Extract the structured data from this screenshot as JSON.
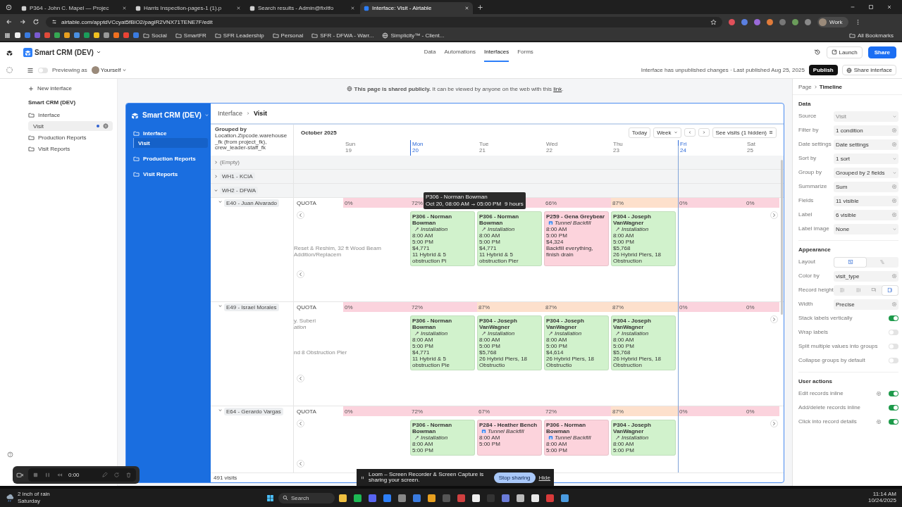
{
  "browser": {
    "tabs": [
      {
        "title": "P364 - John C. Mapel — Projec",
        "selected": false
      },
      {
        "title": "Harris Inspection-pages-1 (1).p",
        "selected": false
      },
      {
        "title": "Search results - Admin@fixitfo",
        "selected": false
      },
      {
        "title": "Interface: Visit - Airtable",
        "selected": true
      }
    ],
    "url": "airtable.com/apptdVCcyat5fBlO2/pagiR2VNX71TENE7F/edit",
    "bookmarks": [
      {
        "label": "Social",
        "kind": "folder"
      },
      {
        "label": "SmartFR",
        "kind": "folder"
      },
      {
        "label": "SFR Leadership",
        "kind": "folder"
      },
      {
        "label": "Personal",
        "kind": "folder"
      },
      {
        "label": "SFR - DFWA - Warr...",
        "kind": "folder"
      },
      {
        "label": "Simplicity™ - Client...",
        "kind": "link"
      }
    ],
    "all_bookmarks": "All Bookmarks",
    "profile": "Work"
  },
  "app": {
    "title": "Smart CRM (DEV)",
    "nav": [
      {
        "label": "Data",
        "selected": false
      },
      {
        "label": "Automations",
        "selected": false
      },
      {
        "label": "Interfaces",
        "selected": true
      },
      {
        "label": "Forms",
        "selected": false
      }
    ],
    "launch": "Launch",
    "share": "Share"
  },
  "subbar": {
    "preview_on": false,
    "previewing": "Previewing as",
    "user": "Yourself",
    "status": "Interface has unpublished changes · Last published Aug 25, 2025",
    "publish": "Publish",
    "share_interface": "Share interface"
  },
  "sidebar": {
    "new": "New interface",
    "base": "Smart CRM (DEV)",
    "items": [
      {
        "label": "Interface",
        "selected": false,
        "children": [
          {
            "label": "Visit",
            "selected": true
          }
        ]
      },
      {
        "label": "Production Reports",
        "selected": false
      },
      {
        "label": "Visit Reports",
        "selected": false
      }
    ]
  },
  "notice": {
    "text": "**This page is shared publicly.** It can be viewed by anyone on the web with this",
    "link": "link",
    "end": "."
  },
  "preview": {
    "title": "Smart CRM (DEV)",
    "nav": [
      {
        "label": "Interface",
        "selected": false,
        "children": [
          {
            "label": "Visit",
            "selected": true
          }
        ]
      },
      {
        "label": "Production Reports",
        "selected": false
      },
      {
        "label": "Visit Reports",
        "selected": false
      }
    ],
    "breadcrumb": [
      "Interface",
      "Visit"
    ],
    "grouped_by_label": "Grouped by",
    "grouped_by": "Location.Zipcode.warehouse_fk (from project_fk), crew_leader-staff_fk",
    "count": "491 visits",
    "timeline": {
      "month": "October 2025",
      "today": "Today",
      "range": "Week",
      "see": "See visits (1 hidden)",
      "days": [
        {
          "name": "Sun",
          "date": "19",
          "highlighted": false,
          "today": false
        },
        {
          "name": "Mon",
          "date": "20",
          "highlighted": true,
          "today": false
        },
        {
          "name": "Tue",
          "date": "21",
          "highlighted": false,
          "today": false
        },
        {
          "name": "Wed",
          "date": "22",
          "highlighted": false,
          "today": false
        },
        {
          "name": "Thu",
          "date": "23",
          "highlighted": false,
          "today": false
        },
        {
          "name": "Fri",
          "date": "24",
          "highlighted": true,
          "today": true
        },
        {
          "name": "Sat",
          "date": "25",
          "highlighted": false,
          "today": false
        }
      ],
      "groups": [
        {
          "label": "(Empty)",
          "expanded": false
        },
        {
          "label": "WH1 - KCIA",
          "expanded": false
        },
        {
          "label": "WH2 - DFWA",
          "expanded": true,
          "children": [
            {
              "label": "E40 - Juan Alvarado",
              "expanded": true,
              "quota_label": "QUOTA",
              "tooltip": {
                "title": "P306 - Norman Bowman",
                "start": "Oct 20, 08:00 AM",
                "end": "05:00 PM",
                "duration": "9 hours"
              },
              "spill": {
                "description": "Reset & Reshim, 32 ft Wood Beam Addition/Replacem"
              },
              "days": [
                {
                  "quota": "0%",
                  "color": "#fbd3dd"
                },
                {
                  "quota": "72%",
                  "color": "#fbd3dd",
                  "card": {
                    "title": "P306 - Norman Bowman",
                    "type": "Installation",
                    "kind": "installation",
                    "start": "8:00 AM",
                    "end": "5:00 PM",
                    "amount": "$4,771",
                    "description": "11 Hybrid & 5 obstruction Pi",
                    "color": "#d1f2cc"
                  }
                },
                {
                  "color": "#fbd3dd",
                  "card": {
                    "title": "P306 - Norman Bowman",
                    "type": "Installation",
                    "kind": "installation",
                    "start": "8:00 AM",
                    "end": "5:00 PM",
                    "amount": "$4,771",
                    "description": "11 Hybrid & 5 obstruction Pier",
                    "color": "#d1f2cc"
                  }
                },
                {
                  "quota": "66%",
                  "color": "#fbd3dd",
                  "card": {
                    "title": "P259 - Gena Greybear",
                    "type": "Tunnel Backfill",
                    "kind": "backfill",
                    "start": "8:00 AM",
                    "end": "5:00 PM",
                    "amount": "$4,324",
                    "description": "Backfill everything, finish drain",
                    "color": "#fcd3dc"
                  }
                },
                {
                  "quota": "87%",
                  "color": "#fde0cc",
                  "card": {
                    "title": "P304 - Joseph VanWagner",
                    "type": "Installation",
                    "kind": "installation",
                    "start": "8:00 AM",
                    "end": "5:00 PM",
                    "amount": "$5,768",
                    "description": "26 Hybrid Piers, 18 Obstruction",
                    "color": "#d1f2cc"
                  }
                },
                {
                  "quota": "0%",
                  "color": "#fbd3dd"
                },
                {
                  "quota": "0%",
                  "color": "#fbd3dd"
                }
              ]
            },
            {
              "label": "E49 - Israel Morales",
              "expanded": true,
              "quota_label": "QUOTA",
              "spill": {
                "title": "y. Suberi",
                "type": "ation",
                "description": "nd 8 Obstruction Pier"
              },
              "days": [
                {
                  "quota": "0%",
                  "color": "#fbd3dd"
                },
                {
                  "quota": "72%",
                  "color": "#fbd3dd",
                  "card": {
                    "title": "P306 - Norman Bowman",
                    "type": "Installation",
                    "kind": "installation",
                    "start": "8:00 AM",
                    "end": "5:00 PM",
                    "amount": "$4,771",
                    "description": "11 Hybrid & 5 obstruction Pie",
                    "color": "#d1f2cc"
                  }
                },
                {
                  "quota": "87%",
                  "color": "#fde0cc",
                  "card": {
                    "title": "P304 - Joseph VanWagner",
                    "type": "Installation",
                    "kind": "installation",
                    "start": "8:00 AM",
                    "end": "5:00 PM",
                    "amount": "$5,768",
                    "description": "26 Hybrid Piers, 18 Obstructio",
                    "color": "#d1f2cc"
                  }
                },
                {
                  "quota": "87%",
                  "color": "#fde0cc",
                  "card": {
                    "title": "P304 - Joseph VanWagner",
                    "type": "Installation",
                    "kind": "installation",
                    "start": "8:00 AM",
                    "end": "5:00 PM",
                    "amount": "$4,614",
                    "description": "26 Hybrid Piers, 18 Obstructio",
                    "color": "#d1f2cc"
                  }
                },
                {
                  "quota": "87%",
                  "color": "#fde0cc",
                  "card": {
                    "title": "P304 - Joseph VanWagner",
                    "type": "Installation",
                    "kind": "installation",
                    "start": "8:00 AM",
                    "end": "5:00 PM",
                    "amount": "$5,768",
                    "description": "26 Hybrid Piers, 18 Obstruction",
                    "color": "#d1f2cc"
                  }
                },
                {
                  "quota": "0%",
                  "color": "#fbd3dd"
                },
                {
                  "quota": "0%",
                  "color": "#fbd3dd"
                }
              ]
            },
            {
              "label": "E64 - Gerardo Vargas",
              "expanded": true,
              "quota_label": "QUOTA",
              "days": [
                {
                  "quota": "0%",
                  "color": "#fbd3dd"
                },
                {
                  "quota": "72%",
                  "color": "#fbd3dd",
                  "card": {
                    "title": "P306 - Norman Bowman",
                    "type": "Installation",
                    "kind": "installation",
                    "start": "8:00 AM",
                    "end": "5:00 PM",
                    "color": "#d1f2cc"
                  }
                },
                {
                  "quota": "67%",
                  "color": "#fbd3dd",
                  "card": {
                    "title": "P284 - Heather Bench",
                    "type": "Tunnel Backfill",
                    "kind": "backfill",
                    "start": "8:00 AM",
                    "end": "5:00 PM",
                    "color": "#fcd3dc"
                  }
                },
                {
                  "quota": "72%",
                  "color": "#fbd3dd",
                  "card": {
                    "title": "P306 - Norman Bowman",
                    "type": "Tunnel Backfill",
                    "kind": "backfill",
                    "start": "8:00 AM",
                    "end": "5:00 PM",
                    "color": "#fcd3dc"
                  }
                },
                {
                  "quota": "87%",
                  "color": "#fde0cc",
                  "card": {
                    "title": "P304 - Joseph VanWagner",
                    "type": "Installation",
                    "kind": "installation",
                    "start": "8:00 AM",
                    "end": "5:00 PM",
                    "color": "#d1f2cc"
                  }
                },
                {
                  "quota": "0%",
                  "color": "#fbd3dd"
                },
                {
                  "quota": "0%",
                  "color": "#fbd3dd"
                }
              ]
            }
          ]
        }
      ]
    }
  },
  "panel": {
    "crumb": "Page",
    "current": "Timeline",
    "sections": [
      {
        "title": "Data",
        "rows": [
          {
            "label": "Source",
            "kind": "select",
            "value": "Visit",
            "disabled": true
          },
          {
            "label": "Filter by",
            "kind": "config",
            "value": "1 condition",
            "disabled": false
          },
          {
            "label": "Date settings",
            "kind": "config",
            "value": "Date settings",
            "disabled": false
          },
          {
            "label": "Sort by",
            "kind": "select",
            "value": "1 sort",
            "disabled": false
          },
          {
            "label": "Group by",
            "kind": "select",
            "value": "Grouped by 2 fields",
            "disabled": false
          },
          {
            "label": "Summarize",
            "kind": "config",
            "value": "Sum",
            "disabled": false
          },
          {
            "label": "Fields",
            "kind": "config",
            "value": "11 visible",
            "disabled": false
          },
          {
            "label": "Label",
            "kind": "config",
            "value": "6 visible",
            "disabled": false
          },
          {
            "label": "Label image",
            "kind": "select",
            "value": "None",
            "disabled": false
          }
        ]
      },
      {
        "title": "Appearance",
        "rows": [
          {
            "label": "Layout",
            "kind": "segmented",
            "options": [
              {
                "kind": "timeline",
                "selected": true
              },
              {
                "kind": "gantt",
                "selected": false
              }
            ]
          },
          {
            "label": "Color by",
            "kind": "config",
            "value": "visit_type",
            "disabled": false
          },
          {
            "label": "Record height",
            "kind": "segmented",
            "options": [
              {
                "kind": "xsmall",
                "selected": false
              },
              {
                "kind": "small",
                "selected": false
              },
              {
                "kind": "medium",
                "selected": false
              },
              {
                "kind": "large",
                "selected": true
              }
            ]
          },
          {
            "label": "Width",
            "kind": "config",
            "value": "Precise",
            "disabled": false
          },
          {
            "label": "Stack labels vertically",
            "kind": "toggle",
            "on": true,
            "gear": false
          },
          {
            "label": "Wrap labels",
            "kind": "toggle",
            "on": false,
            "gear": false
          },
          {
            "label": "Split multiple values into groups",
            "kind": "toggle",
            "on": false,
            "gear": false
          },
          {
            "label": "Collapse groups by default",
            "kind": "toggle",
            "on": false,
            "gear": false
          }
        ]
      },
      {
        "title": "User actions",
        "rows": [
          {
            "label": "Edit records inline",
            "kind": "toggle",
            "on": true,
            "gear": true
          },
          {
            "label": "Add/delete records inline",
            "kind": "toggle",
            "on": true,
            "gear": false
          },
          {
            "label": "Click into record details",
            "kind": "toggle",
            "on": true,
            "gear": true
          }
        ]
      }
    ]
  },
  "loom": {
    "time": "0:00",
    "banner": "Loom – Screen Recorder & Screen Capture is sharing your screen.",
    "stop": "Stop sharing",
    "hide": "Hide"
  },
  "taskbar": {
    "weather": "2 inch of rain",
    "day": "Saturday",
    "search": "Search",
    "time": "11:14 AM",
    "date": "10/24/2025"
  }
}
